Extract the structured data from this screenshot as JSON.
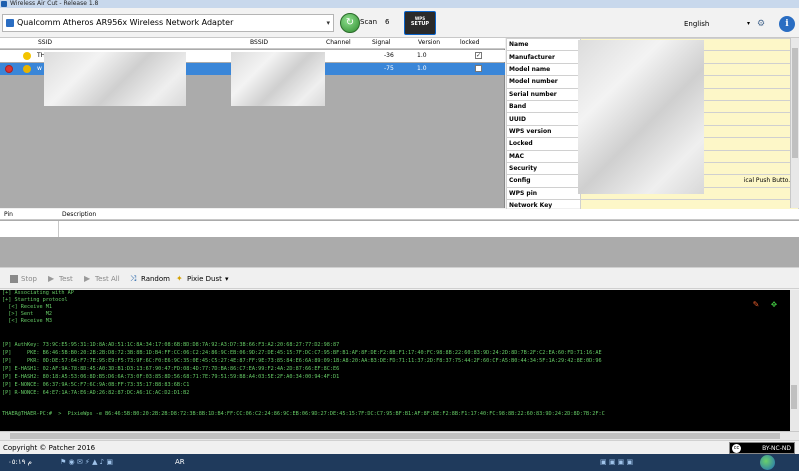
{
  "window": {
    "title": "Wireless Air Cut - Release 1.8"
  },
  "toolbar": {
    "adapter": "Qualcomm Atheros AR956x Wireless Network Adapter",
    "scan_label": "Scan",
    "scan_count": "6",
    "wps_badge_line1": "WPS",
    "wps_badge_line2": "SETUP",
    "language": "English"
  },
  "networks": {
    "columns": [
      "SSID",
      "BSSID",
      "Channel",
      "Signal",
      "Version",
      "locked"
    ],
    "rows": [
      {
        "ssid_prefix": "TH",
        "signal": "-36",
        "version": "1.0",
        "locked": "✓"
      },
      {
        "ssid_prefix": "w",
        "signal": "-75",
        "version": "1.0",
        "locked": ""
      }
    ]
  },
  "details": {
    "header": "Name",
    "fields": [
      "Manufacturer",
      "Model name",
      "Model number",
      "Serial number",
      "Band",
      "UUID",
      "WPS version",
      "Locked",
      "MAC",
      "Security",
      "Config",
      "WPS pin",
      "Network Key"
    ],
    "config_value": "ical Push Butto..."
  },
  "pins": {
    "columns": [
      "Pin",
      "Description"
    ]
  },
  "actions": {
    "stop": "Stop",
    "test": "Test",
    "test_all": "Test All",
    "random": "Random",
    "pixie_dust": "Pixie Dust"
  },
  "console": {
    "lines": [
      "[+] Associating with AP",
      "[+] Starting protocol",
      "  [<] Receive M1",
      "  [>] Sent    M2",
      "  [<] Receive M3",
      "",
      "[P] AuthKey: 73:9C:E5:95:31:1D:8A:AD:51:1C:8A:34:17:08:6B:BD:D8:7A:92:A3:D7:3B:66:F3:A2:20:68:27:77:D2:98:87",
      "[P]     PKE: B6:46:5B:B0:20:2B:2B:D8:72:3B:8B:1D:B4:FF:CC:06:C2:24:86:9C:EB:06:9D:27:DE:45:15:7F:DC:C7:95:BF:B1:AF:8F:DE:F2:8B:F1:17:40:FC:98:8B:22:60:83:9D:24:2D:8D:7B:2F:C2:EA:60:FD:71:16:AE",
      "[P]     PKR: 0D:DE:57:64:F7:7E:95:E9:F5:73:9F:6C:F0:E6:9C:35:0E:45:C5:27:4E:87:FF:9E:73:85:84:E6:6A:89:09:1B:A8:20:AA:B3:DE:FD:71:11:37:2D:F8:37:75:44:2F:60:CF:A5:B0:44:34:5F:1A:29:42:8E:0D:96",
      "[P] E-HASH1: 02:AF:9A:78:8D:45:A0:3D:B1:D3:13:67:90:47:FD:08:4D:77:7D:BA:86:C7:EA:99:F2:4A:2D:87:66:EF:8C:E6",
      "[P] E-HASH2: 80:18:A5:53:06:8D:B5:D6:6A:73:0F:03:85:8D:56:68:71:7E:79:51:59:B8:A4:03:5E:2F:A0:34:00:94:4F:D1",
      "[P] E-NONCE: 06:37:9A:5C:F7:6C:9A:0B:FF:73:35:17:B8:83:6B:C1",
      "[P] R-NONCE: 64:E7:1A:7A:E6:AD:26:82:87:DC:A6:1C:AC:D2:D1:B2",
      "",
      "THAER@THAER-PC:#  >  PixieWps -e B6:46:5B:B0:20:2B:2B:D8:72:3B:8B:1D:B4:FF:CC:06:C2:24:86:9C:EB:06:9D:27:DE:45:15:7F:DC:C7:95:BF:B1:AF:8F:DE:F2:8B:F1:17:40:FC:98:8B:22:60:83:9D:24:2D:8D:7B:2F:C"
    ]
  },
  "status": {
    "copyright": "Copyright © Patcher 2016",
    "license": "BY-NC-ND"
  },
  "taskbar": {
    "clock": "م ٠٥:١٩",
    "lang": "AR"
  }
}
